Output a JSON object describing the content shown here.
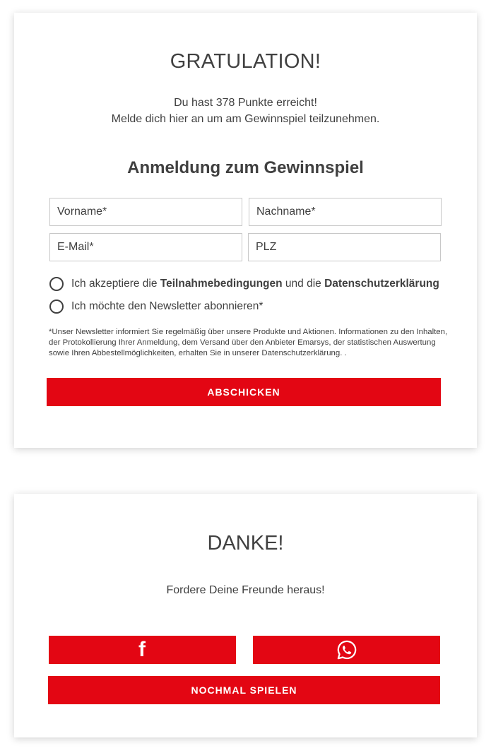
{
  "signup": {
    "title": "GRATULATION!",
    "intro_line1": "Du hast 378 Punkte erreicht!",
    "intro_line2": "Melde dich hier an um am Gewinnspiel teilzunehmen.",
    "form_title": "Anmeldung zum Gewinnspiel",
    "fields": {
      "first_name_placeholder": "Vorname*",
      "last_name_placeholder": "Nachname*",
      "email_placeholder": "E-Mail*",
      "zip_placeholder": "PLZ"
    },
    "terms": {
      "prefix": "Ich akzeptiere die ",
      "terms_link": "Teilnahmebedingungen",
      "middle": " und die ",
      "privacy_link": "Datenschutzerklärung"
    },
    "newsletter_label": "Ich möchte den Newsletter abonnieren*",
    "footnote": "*Unser Newsletter informiert Sie regelmäßig über unsere Produkte und Aktionen. Informationen zu den Inhalten, der Protokollierung Ihrer Anmeldung, dem Versand über den Anbieter Emarsys, der statistischen Auswertung sowie Ihren Abbestellmöglichkeiten, erhalten Sie in unserer Datenschutzerklärung. .",
    "submit_label": "ABSCHICKEN"
  },
  "thanks": {
    "title": "DANKE!",
    "challenge_text": "Fordere Deine Freunde heraus!",
    "facebook_glyph": "f",
    "facebook_icon": "facebook-icon",
    "whatsapp_icon": "whatsapp-icon",
    "replay_label": "NOCHMAL SPIELEN"
  },
  "colors": {
    "accent": "#e30613",
    "text": "#404040",
    "border": "#c8c8c8"
  }
}
